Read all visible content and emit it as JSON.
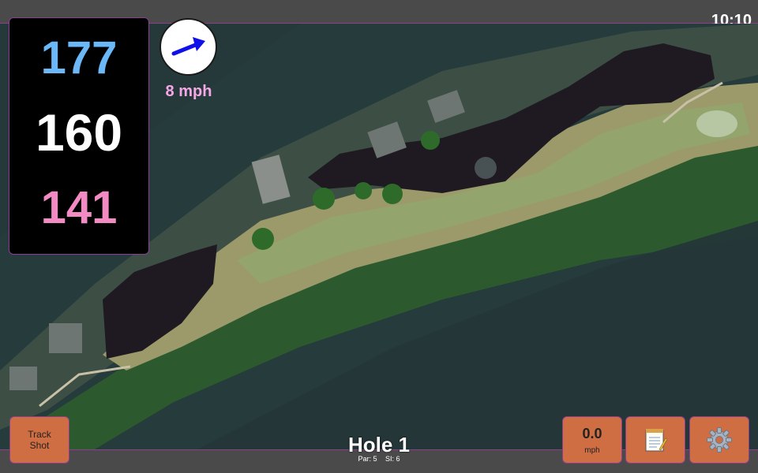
{
  "status_bar": {
    "time": "10:10"
  },
  "distances": {
    "back": {
      "value": "177",
      "color": "#6ab8f7"
    },
    "middle": {
      "value": "160",
      "color": "#ffffff"
    },
    "front": {
      "value": "141",
      "color": "#f28ac3"
    }
  },
  "wind": {
    "speed": "8 mph",
    "speed_color": "#f6a8e6",
    "arrow_icon": "wind-direction-arrow-icon",
    "arrow_color": "#1010e8"
  },
  "hole": {
    "title": "Hole 1",
    "par": "Par: 5",
    "si": "SI: 6"
  },
  "buttons": {
    "track_shot_line1": "Track",
    "track_shot_line2": "Shot",
    "speed_value": "0.0",
    "speed_unit": "mph",
    "notes_icon": "notepad-icon",
    "settings_icon": "gear-icon",
    "button_color": "#cf6e43"
  },
  "map": {
    "type": "satellite-hole-view"
  }
}
